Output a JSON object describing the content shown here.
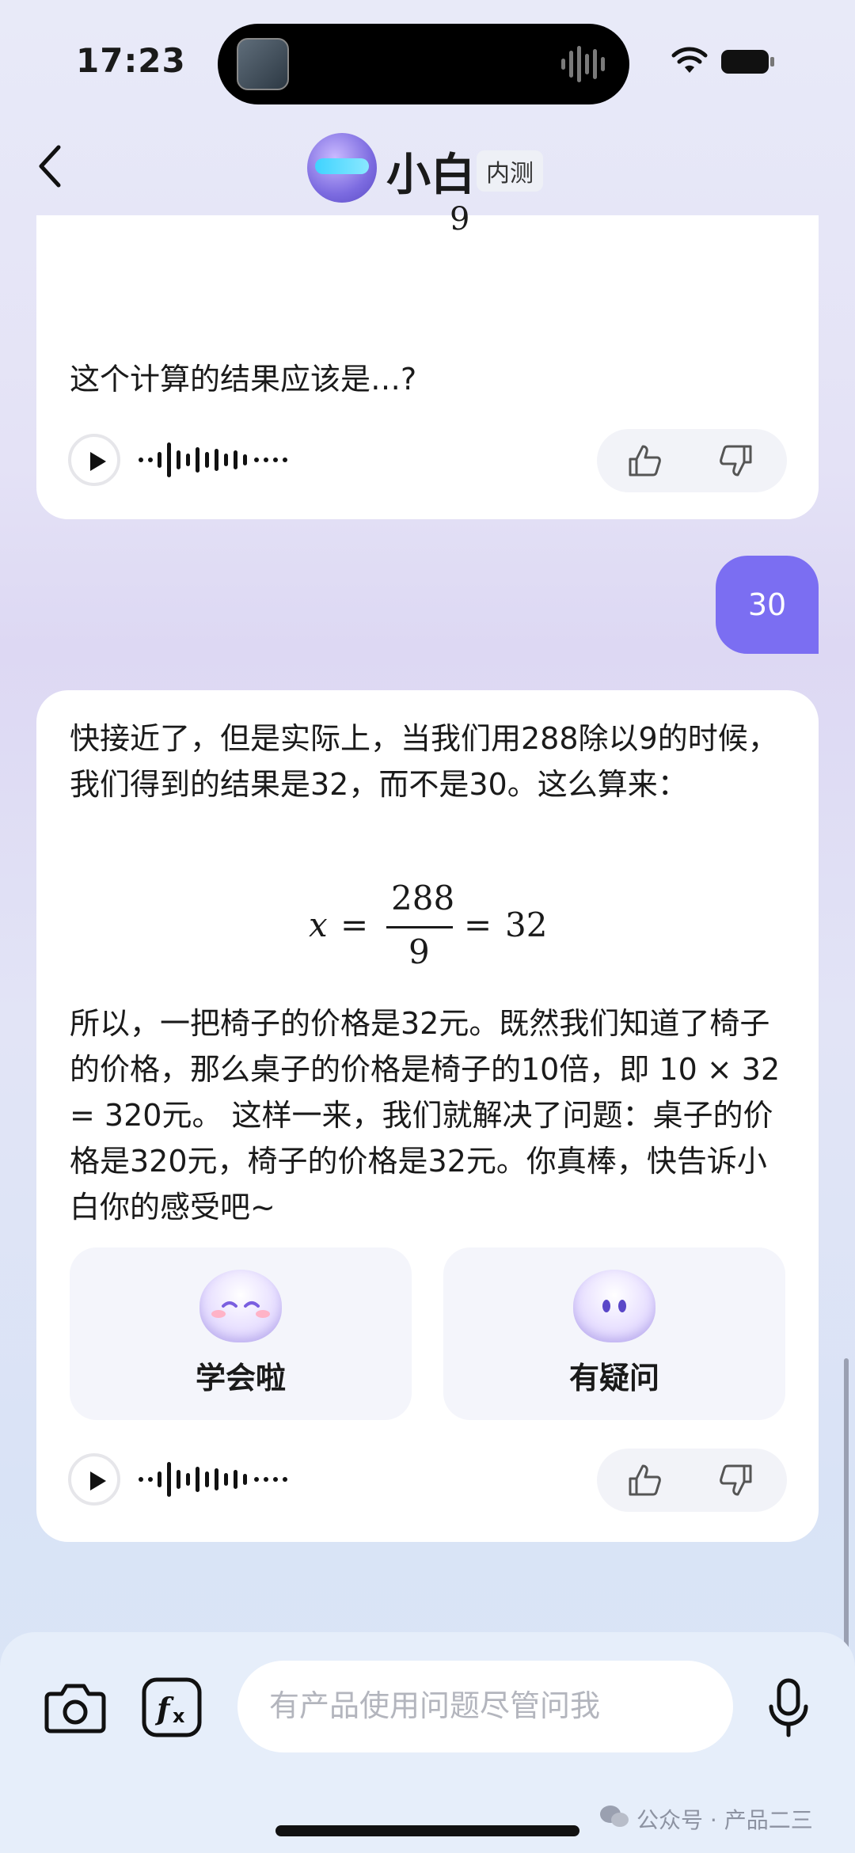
{
  "status": {
    "time": "17:23"
  },
  "nav": {
    "title": "小白",
    "badge": "内测"
  },
  "messages": {
    "prev_bot": {
      "cut_digit": "9",
      "text": "这个计算的结果应该是…?"
    },
    "user": {
      "text": "30"
    },
    "bot": {
      "para1": "快接近了，但是实际上，当我们用288除以9的时候，我们得到的结果是32，而不是30。这么算来：",
      "formula": {
        "var": "x",
        "eq": "=",
        "numerator": "288",
        "denominator": "9",
        "result": "32"
      },
      "para2": "所以，一把椅子的价格是32元。既然我们知道了椅子的价格，那么桌子的价格是椅子的10倍，即 10 × 32 = 320元。 这样一来，我们就解决了问题：桌子的价格是320元，椅子的价格是32元。你真棒，快告诉小白你的感受吧~",
      "answers": [
        {
          "label": "学会啦"
        },
        {
          "label": "有疑问"
        }
      ]
    }
  },
  "input": {
    "placeholder": "有产品使用问题尽管问我"
  },
  "watermark": "公众号 · 产品二三",
  "icons": [
    "back-icon",
    "wifi-icon",
    "battery-icon",
    "play-icon",
    "thumbs-up-icon",
    "thumbs-down-icon",
    "camera-icon",
    "formula-icon",
    "microphone-icon"
  ],
  "colors": {
    "accent": "#7b6ef2",
    "card": "#ffffff",
    "input_bg": "#ffffff"
  }
}
